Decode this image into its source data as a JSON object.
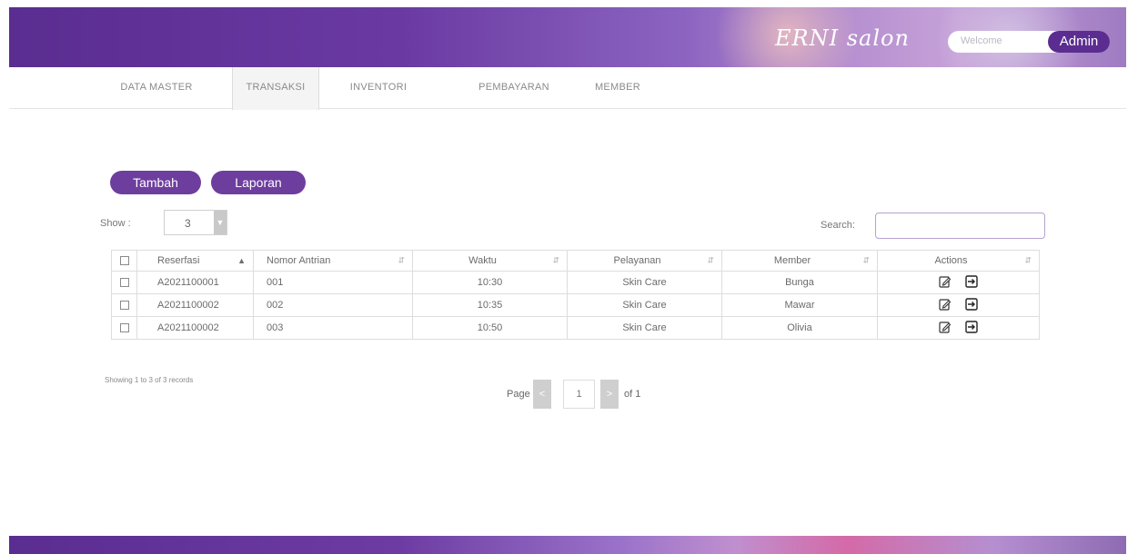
{
  "header": {
    "brand": "ERNI salon",
    "welcome": "Welcome",
    "user": "Admin"
  },
  "nav": {
    "tabs": [
      {
        "label": "DATA MASTER"
      },
      {
        "label": "TRANSAKSI"
      },
      {
        "label": "INVENTORI"
      },
      {
        "label": "PEMBAYARAN"
      },
      {
        "label": "MEMBER"
      }
    ],
    "active": "TRANSAKSI"
  },
  "actions": {
    "add_label": "Tambah",
    "report_label": "Laporan"
  },
  "controls": {
    "show_label": "Show :",
    "show_value": "3",
    "search_label": "Search:",
    "search_value": ""
  },
  "table": {
    "headers": [
      "Reserfasi",
      "Nomor Antrian",
      "Waktu",
      "Pelayanan",
      "Member",
      "Actions"
    ],
    "rows": [
      {
        "reserfasi": "A2021100001",
        "antrian": "001",
        "waktu": "10:30",
        "pelayanan": "Skin Care",
        "member": "Bunga"
      },
      {
        "reserfasi": "A2021100002",
        "antrian": "002",
        "waktu": "10:35",
        "pelayanan": "Skin Care",
        "member": "Mawar"
      },
      {
        "reserfasi": "A2021100002",
        "antrian": "003",
        "waktu": "10:50",
        "pelayanan": "Skin Care",
        "member": "Olivia"
      }
    ]
  },
  "footer_info": {
    "records": "Showing 1 to 3 of 3 records"
  },
  "pager": {
    "page_label": "Page",
    "prev": "<",
    "current": "1",
    "next": ">",
    "of_label": "of 1"
  },
  "icons": {
    "edit": "edit-icon",
    "login": "sign-in-icon",
    "sort": "sort-icon",
    "dropdown": "chevron-down-icon"
  },
  "colors": {
    "brand_purple": "#6d3e9e",
    "header_dark": "#5a2d91"
  }
}
